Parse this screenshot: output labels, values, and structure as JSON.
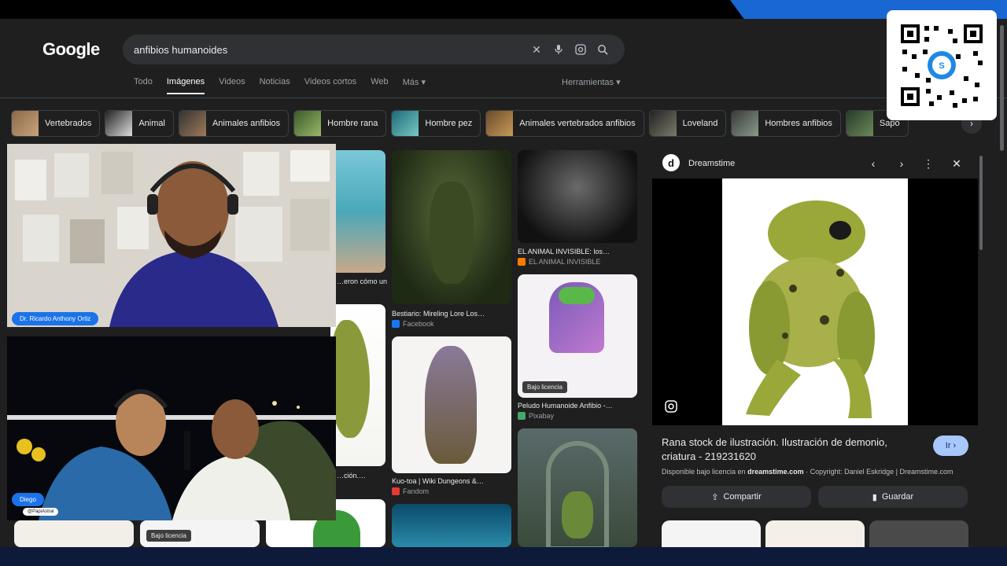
{
  "header": {
    "logo": "Google",
    "query": "anfibios humanoides",
    "tabs": [
      "Todo",
      "Imágenes",
      "Videos",
      "Noticias",
      "Videos cortos",
      "Web",
      "Más ▾"
    ],
    "active_tab": "Imágenes",
    "tools": "Herramientas ▾"
  },
  "chips": [
    "Vertebrados",
    "Animal",
    "Animales anfibios",
    "Hombre rana",
    "Hombre pez",
    "Animales vertebrados anfibios",
    "Loveland",
    "Hombres anfibios",
    "Sapo"
  ],
  "results": {
    "col_a_1": "…eron cómo un…",
    "col_a_2": "…ción.…",
    "c2_title": "Bestiario: Mireling Lore Los…",
    "c2_source": "Facebook",
    "c3_title": "Kuo-toa | Wiki Dungeons &…",
    "c3_source": "Fandom",
    "c4_title": "EL ANIMAL INVISIBLE: los…",
    "c4_source": "EL ANIMAL INVISIBLE",
    "c5_title": "Peludo Humanoide Anfibio -…",
    "c5_source": "Pixabay",
    "license_badge": "Bajo licencia",
    "license_badge_2": "Bajo licencia"
  },
  "panel": {
    "source": "Dreamstime",
    "title": "Rana stock de ilustración. Ilustración de demonio, criatura - 219231620",
    "go_label": "Ir ›",
    "license_prefix": "Disponible bajo licencia en ",
    "license_site": "dreamstime.com",
    "copyright": " · Copyright: Daniel Eskridge | Dreamstime.com",
    "share_label": "Compartir",
    "save_label": "Guardar"
  },
  "cams": {
    "name1": "Dr. Ricardo Anthony Ortiz",
    "name2": "Diego",
    "handle2": "@PapiAstral"
  },
  "colors": {
    "accent": "#1a73e8",
    "bg": "#1f1f1f",
    "go_button": "#a8c7fa"
  }
}
